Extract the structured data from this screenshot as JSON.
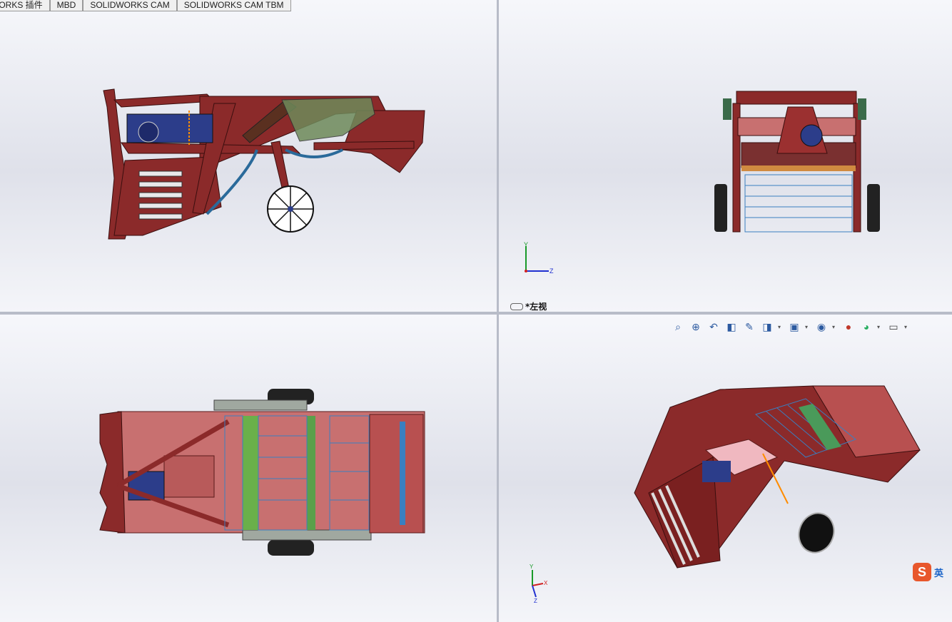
{
  "command_manager": {
    "tabs": [
      "WORKS 插件",
      "MBD",
      "SOLIDWORKS CAM",
      "SOLIDWORKS CAM TBM"
    ]
  },
  "viewports": {
    "top_right": {
      "view_label": "*左视"
    },
    "bottom_right": {
      "heads_up_toolbar": [
        "zoom-to-fit-icon",
        "zoom-to-area-icon",
        "previous-view-icon",
        "section-view-icon",
        "dynamic-annotation-icon",
        "view-orientation-icon",
        "display-style-icon",
        "hide-show-icon",
        "edit-appearance-icon",
        "apply-scene-icon",
        "view-settings-icon"
      ]
    }
  },
  "triad_labels": {
    "x": "X",
    "y": "Y",
    "z": "Z"
  },
  "ime": {
    "logo": "S",
    "mode": "英"
  },
  "colors": {
    "frame": "#8b2a2a",
    "frame_light": "#c87070",
    "steel_blue": "#3a7fc0",
    "motor": "#2c3d8a",
    "green": "#4a9a5a"
  }
}
